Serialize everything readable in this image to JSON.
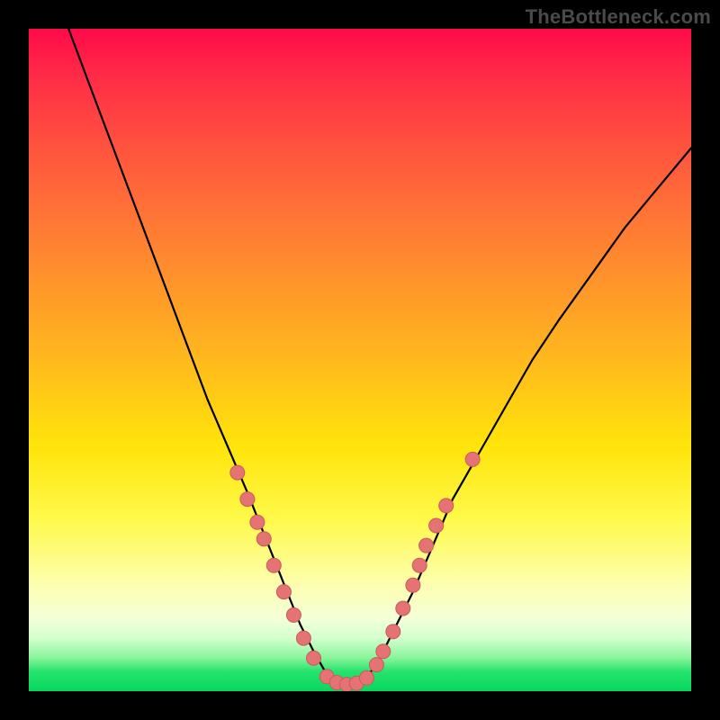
{
  "watermark": "TheBottleneck.com",
  "colors": {
    "frame": "#000000",
    "curve": "#000000",
    "dot_fill": "#e57373",
    "dot_stroke": "#c95b5b"
  },
  "chart_data": {
    "type": "line",
    "title": "",
    "xlabel": "",
    "ylabel": "",
    "xlim": [
      0,
      100
    ],
    "ylim": [
      0,
      100
    ],
    "grid": false,
    "note": "Axes are implied (no tick labels shown). x spans the plot horizontally, y is vertical with 0 at bottom. Values are read off pixel positions.",
    "series": [
      {
        "name": "bottleneck-curve",
        "x": [
          6,
          9,
          12,
          15,
          18,
          21,
          24,
          27,
          30,
          33,
          35,
          37,
          39,
          41,
          43,
          45,
          47,
          49,
          51,
          53,
          55,
          58,
          61,
          64,
          68,
          72,
          76,
          80,
          85,
          90,
          95,
          100
        ],
        "y": [
          100,
          92,
          84,
          76,
          68,
          60,
          52,
          44,
          37,
          30,
          25,
          20,
          15,
          10,
          6,
          2.5,
          1,
          1,
          2,
          5,
          9,
          15,
          22,
          29,
          36,
          43,
          50,
          56,
          63,
          70,
          76,
          82
        ]
      }
    ],
    "points": [
      {
        "name": "left-cluster",
        "x": 31.5,
        "y": 33
      },
      {
        "name": "left-cluster",
        "x": 33.0,
        "y": 29
      },
      {
        "name": "left-cluster",
        "x": 34.5,
        "y": 25.5
      },
      {
        "name": "left-cluster",
        "x": 35.5,
        "y": 23
      },
      {
        "name": "left-cluster",
        "x": 37.0,
        "y": 19
      },
      {
        "name": "left-cluster",
        "x": 38.5,
        "y": 15
      },
      {
        "name": "left-cluster",
        "x": 40.0,
        "y": 11.5
      },
      {
        "name": "left-cluster",
        "x": 41.5,
        "y": 8
      },
      {
        "name": "left-cluster",
        "x": 43.0,
        "y": 5
      },
      {
        "name": "valley",
        "x": 45.0,
        "y": 2.2
      },
      {
        "name": "valley",
        "x": 46.5,
        "y": 1.3
      },
      {
        "name": "valley",
        "x": 48.0,
        "y": 1.0
      },
      {
        "name": "valley",
        "x": 49.5,
        "y": 1.2
      },
      {
        "name": "valley",
        "x": 51.0,
        "y": 2.0
      },
      {
        "name": "right-cluster",
        "x": 52.5,
        "y": 4
      },
      {
        "name": "right-cluster",
        "x": 53.5,
        "y": 6
      },
      {
        "name": "right-cluster",
        "x": 55.0,
        "y": 9
      },
      {
        "name": "right-cluster",
        "x": 56.5,
        "y": 12.5
      },
      {
        "name": "right-cluster",
        "x": 58.0,
        "y": 16
      },
      {
        "name": "right-cluster",
        "x": 59.0,
        "y": 19
      },
      {
        "name": "right-cluster",
        "x": 60.0,
        "y": 22
      },
      {
        "name": "right-cluster",
        "x": 61.5,
        "y": 25
      },
      {
        "name": "right-cluster",
        "x": 63.0,
        "y": 28
      },
      {
        "name": "right-outlier",
        "x": 67.0,
        "y": 35
      }
    ],
    "dot_radius": 8
  }
}
